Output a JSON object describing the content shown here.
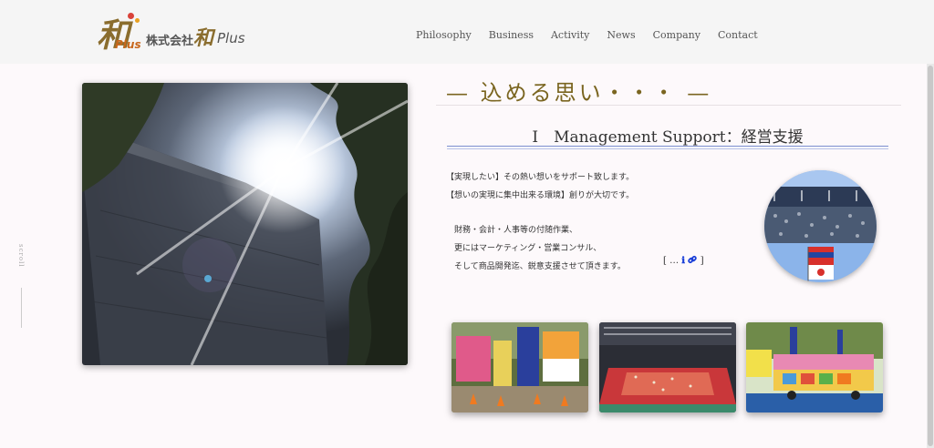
{
  "header": {
    "logo": {
      "kanji": "和",
      "plus": "Plus",
      "company_name": "株式会社",
      "brand_kanji": "和",
      "brand_plus": "Plus"
    },
    "nav": [
      {
        "label": "Philosophy"
      },
      {
        "label": "Business"
      },
      {
        "label": "Activity"
      },
      {
        "label": "News"
      },
      {
        "label": "Company"
      },
      {
        "label": "Contact"
      }
    ]
  },
  "sidebar": {
    "vertical_text": "scroll"
  },
  "main": {
    "section_title": "— 込める思い・・・ —",
    "sub_heading": "Ⅰ　Management Support：経営支援",
    "paragraph1": [
      "【実現したい】その熱い想いをサポート致します。",
      "【想いの実現に集中出来る環境】創りが大切です。"
    ],
    "paragraph2": [
      "財務・会計・人事等の付随作業、",
      "更にはマーケティング・営業コンサル、",
      "そして商品開発迄、鋭意支援させて頂きます。"
    ],
    "more": {
      "open": "[ …",
      "info_icon": "ℹ",
      "link_icon": "🔗",
      "close": "]"
    }
  },
  "colors": {
    "accent_gold": "#7a6520",
    "link_blue": "#1a3fd8",
    "rule_blue": "#7b8fcf"
  }
}
